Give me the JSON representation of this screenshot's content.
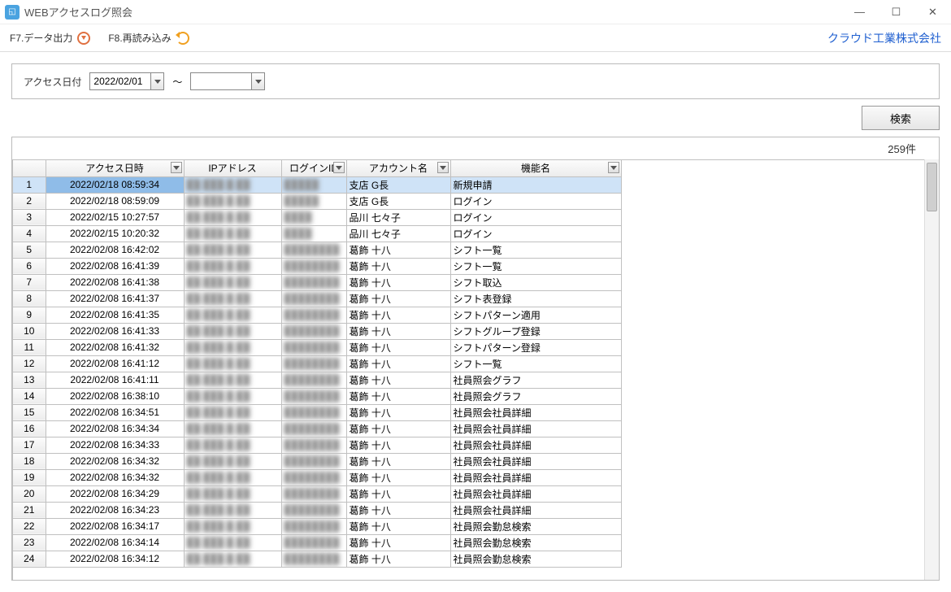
{
  "window": {
    "title": "WEBアクセスログ照会"
  },
  "toolbar": {
    "export_label": "F7.データ出力",
    "reload_label": "F8.再読み込み",
    "company_label": "クラウド工業株式会社"
  },
  "filter": {
    "date_label": "アクセス日付",
    "from_value": "2022/02/01",
    "to_value": "",
    "tilde": "～"
  },
  "actions": {
    "search_label": "検索"
  },
  "results": {
    "count_label": "259件"
  },
  "columns": {
    "datetime": "アクセス日時",
    "ip": "IPアドレス",
    "login": "ログインID",
    "account": "アカウント名",
    "function": "機能名"
  },
  "rows": [
    {
      "n": 1,
      "dt": "2022/02/18 08:59:34",
      "ip": "██.███.█.██",
      "login": "█████",
      "acc": "支店 G長",
      "fn": "新規申請",
      "sel": true
    },
    {
      "n": 2,
      "dt": "2022/02/18 08:59:09",
      "ip": "██.███.█.██",
      "login": "█████",
      "acc": "支店 G長",
      "fn": "ログイン"
    },
    {
      "n": 3,
      "dt": "2022/02/15 10:27:57",
      "ip": "██.███.█.██",
      "login": "████",
      "acc": "品川 七々子",
      "fn": "ログイン"
    },
    {
      "n": 4,
      "dt": "2022/02/15 10:20:32",
      "ip": "██.███.█.██",
      "login": "████",
      "acc": "品川 七々子",
      "fn": "ログイン"
    },
    {
      "n": 5,
      "dt": "2022/02/08 16:42:02",
      "ip": "██.███.█.██",
      "login": "████████",
      "acc": "葛飾 十八",
      "fn": "シフト一覧"
    },
    {
      "n": 6,
      "dt": "2022/02/08 16:41:39",
      "ip": "██.███.█.██",
      "login": "████████",
      "acc": "葛飾 十八",
      "fn": "シフト一覧"
    },
    {
      "n": 7,
      "dt": "2022/02/08 16:41:38",
      "ip": "██.███.█.██",
      "login": "████████",
      "acc": "葛飾 十八",
      "fn": "シフト取込"
    },
    {
      "n": 8,
      "dt": "2022/02/08 16:41:37",
      "ip": "██.███.█.██",
      "login": "████████",
      "acc": "葛飾 十八",
      "fn": "シフト表登録"
    },
    {
      "n": 9,
      "dt": "2022/02/08 16:41:35",
      "ip": "██.███.█.██",
      "login": "████████",
      "acc": "葛飾 十八",
      "fn": "シフトパターン適用"
    },
    {
      "n": 10,
      "dt": "2022/02/08 16:41:33",
      "ip": "██.███.█.██",
      "login": "████████",
      "acc": "葛飾 十八",
      "fn": "シフトグループ登録"
    },
    {
      "n": 11,
      "dt": "2022/02/08 16:41:32",
      "ip": "██.███.█.██",
      "login": "████████",
      "acc": "葛飾 十八",
      "fn": "シフトパターン登録"
    },
    {
      "n": 12,
      "dt": "2022/02/08 16:41:12",
      "ip": "██.███.█.██",
      "login": "████████",
      "acc": "葛飾 十八",
      "fn": "シフト一覧"
    },
    {
      "n": 13,
      "dt": "2022/02/08 16:41:11",
      "ip": "██.███.█.██",
      "login": "████████",
      "acc": "葛飾 十八",
      "fn": "社員照会グラフ"
    },
    {
      "n": 14,
      "dt": "2022/02/08 16:38:10",
      "ip": "██.███.█.██",
      "login": "████████",
      "acc": "葛飾 十八",
      "fn": "社員照会グラフ"
    },
    {
      "n": 15,
      "dt": "2022/02/08 16:34:51",
      "ip": "██.███.█.██",
      "login": "████████",
      "acc": "葛飾 十八",
      "fn": "社員照会社員詳細"
    },
    {
      "n": 16,
      "dt": "2022/02/08 16:34:34",
      "ip": "██.███.█.██",
      "login": "████████",
      "acc": "葛飾 十八",
      "fn": "社員照会社員詳細"
    },
    {
      "n": 17,
      "dt": "2022/02/08 16:34:33",
      "ip": "██.███.█.██",
      "login": "████████",
      "acc": "葛飾 十八",
      "fn": "社員照会社員詳細"
    },
    {
      "n": 18,
      "dt": "2022/02/08 16:34:32",
      "ip": "██.███.█.██",
      "login": "████████",
      "acc": "葛飾 十八",
      "fn": "社員照会社員詳細"
    },
    {
      "n": 19,
      "dt": "2022/02/08 16:34:32",
      "ip": "██.███.█.██",
      "login": "████████",
      "acc": "葛飾 十八",
      "fn": "社員照会社員詳細"
    },
    {
      "n": 20,
      "dt": "2022/02/08 16:34:29",
      "ip": "██.███.█.██",
      "login": "████████",
      "acc": "葛飾 十八",
      "fn": "社員照会社員詳細"
    },
    {
      "n": 21,
      "dt": "2022/02/08 16:34:23",
      "ip": "██.███.█.██",
      "login": "████████",
      "acc": "葛飾 十八",
      "fn": "社員照会社員詳細"
    },
    {
      "n": 22,
      "dt": "2022/02/08 16:34:17",
      "ip": "██.███.█.██",
      "login": "████████",
      "acc": "葛飾 十八",
      "fn": "社員照会勤怠検索"
    },
    {
      "n": 23,
      "dt": "2022/02/08 16:34:14",
      "ip": "██.███.█.██",
      "login": "████████",
      "acc": "葛飾 十八",
      "fn": "社員照会勤怠検索"
    },
    {
      "n": 24,
      "dt": "2022/02/08 16:34:12",
      "ip": "██.███.█.██",
      "login": "████████",
      "acc": "葛飾 十八",
      "fn": "社員照会勤怠検索"
    }
  ]
}
